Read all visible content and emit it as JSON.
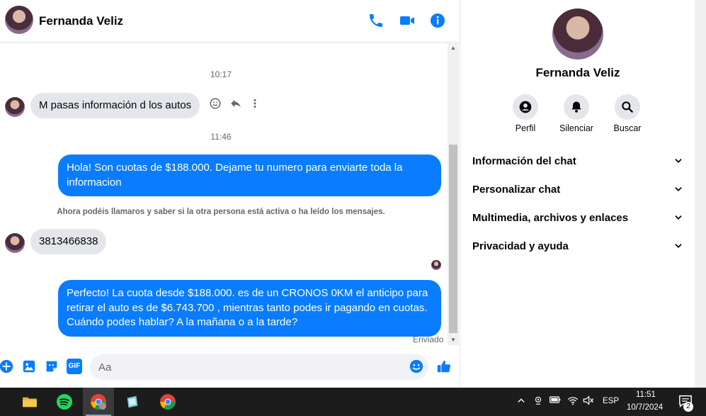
{
  "colors": {
    "accent": "#0a7cff",
    "bubble_in": "#e4e6eb",
    "taskbar": "#1c1c1c"
  },
  "chat": {
    "contact_name": "Fernanda Veliz",
    "header_icons": [
      "phone-icon",
      "video-camera-icon",
      "info-icon"
    ],
    "messages": {
      "time_1": "10:17",
      "in_1": "M pasas información  d los autos",
      "time_2": "11:46",
      "out_1": "Hola! Son cuotas de $188.000. Dejame tu numero para enviarte toda la informacion",
      "system_note": "Ahora podéis llamaros y saber si la otra persona está activa o ha leído los mensajes.",
      "in_2": "3813466838",
      "out_2": "Perfecto! La cuota desde $188.000. es de un CRONOS 0KM el anticipo para retirar el auto es de $6.743.700 , mientras tanto podes ir pagando en cuotas. Cuándo podes hablar? A la mañana o a la tarde?",
      "status": "Enviado"
    },
    "composer": {
      "placeholder": "Aa",
      "gif_label": "GIF"
    }
  },
  "info_panel": {
    "name": "Fernanda Veliz",
    "actions": [
      {
        "label": "Perfil",
        "icon": "profile-icon"
      },
      {
        "label": "Silenciar",
        "icon": "bell-icon"
      },
      {
        "label": "Buscar",
        "icon": "search-icon"
      }
    ],
    "sections": [
      "Información del chat",
      "Personalizar chat",
      "Multimedia, archivos y enlaces",
      "Privacidad y ayuda"
    ]
  },
  "taskbar": {
    "apps": [
      "file-explorer-icon",
      "spotify-icon",
      "chrome-profile-icon",
      "notes-app-icon",
      "chrome-icon"
    ],
    "language": "ESP",
    "time": "11:51",
    "date": "10/7/2024",
    "notification_count": "2"
  }
}
